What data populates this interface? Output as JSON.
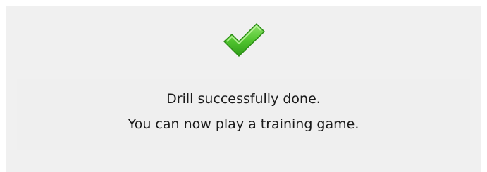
{
  "dialog": {
    "icon": "check-mark-icon",
    "accent_color": "#4fbf2e",
    "message_line_1": "Drill successfully done.",
    "message_line_2": "You can now play a training game."
  }
}
